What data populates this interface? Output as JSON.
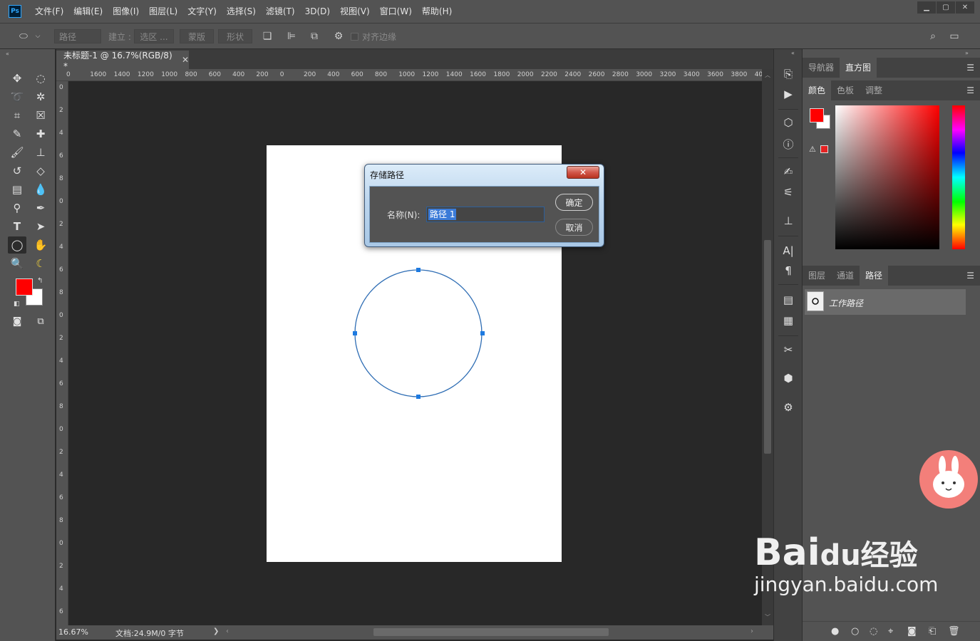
{
  "menubar": {
    "app_logo": "Ps",
    "items": [
      "文件(F)",
      "编辑(E)",
      "图像(I)",
      "图层(L)",
      "文字(Y)",
      "选择(S)",
      "滤镜(T)",
      "3D(D)",
      "视图(V)",
      "窗口(W)",
      "帮助(H)"
    ]
  },
  "options": {
    "mode": "路径",
    "build_label": "建立 :",
    "selection_btn": "选区 ...",
    "mask_btn": "蒙版",
    "shape_btn": "形状",
    "align_edges": "对齐边缘"
  },
  "document": {
    "tab_title": "未标题-1 @ 16.7%(RGB/8) *",
    "ruler_h_ticks": [
      "0",
      "1600",
      "1400",
      "1200",
      "1000",
      "800",
      "600",
      "400",
      "200",
      "0",
      "200",
      "400",
      "600",
      "800",
      "1000",
      "1200",
      "1400",
      "1600",
      "1800",
      "2000",
      "2200",
      "2400",
      "2600",
      "2800",
      "3000",
      "3200",
      "3400",
      "3600",
      "3800",
      "4000"
    ],
    "ruler_v_ticks": [
      "0",
      "2",
      "4",
      "6",
      "8",
      "0",
      "2",
      "4",
      "6",
      "8",
      "0",
      "2",
      "4",
      "6",
      "8",
      "0",
      "2",
      "4",
      "6",
      "8",
      "0",
      "2",
      "4",
      "6",
      "8"
    ]
  },
  "status": {
    "zoom": "16.67%",
    "doc_info": "文档:24.9M/0 字节",
    "arrow": "❯"
  },
  "dialog": {
    "title": "存储路径",
    "close": "✕",
    "name_label": "名称(N):",
    "name_value": "路径 1",
    "ok": "确定",
    "cancel": "取消"
  },
  "panels": {
    "top_tabs": [
      "导航器",
      "直方图"
    ],
    "color_tabs": [
      "颜色",
      "色板",
      "调整"
    ],
    "layers_tabs": [
      "图层",
      "通道",
      "路径"
    ],
    "path_item": "工作路径",
    "foreground_color": "#ff0000",
    "background_color": "#ffffff"
  },
  "watermark": {
    "brand": "Bai",
    "brand_suffix": "du经验",
    "url": "jingyan.baidu.com"
  },
  "colors": {
    "path_stroke": "#2e6db4",
    "anchor": "#1e7ae0"
  }
}
